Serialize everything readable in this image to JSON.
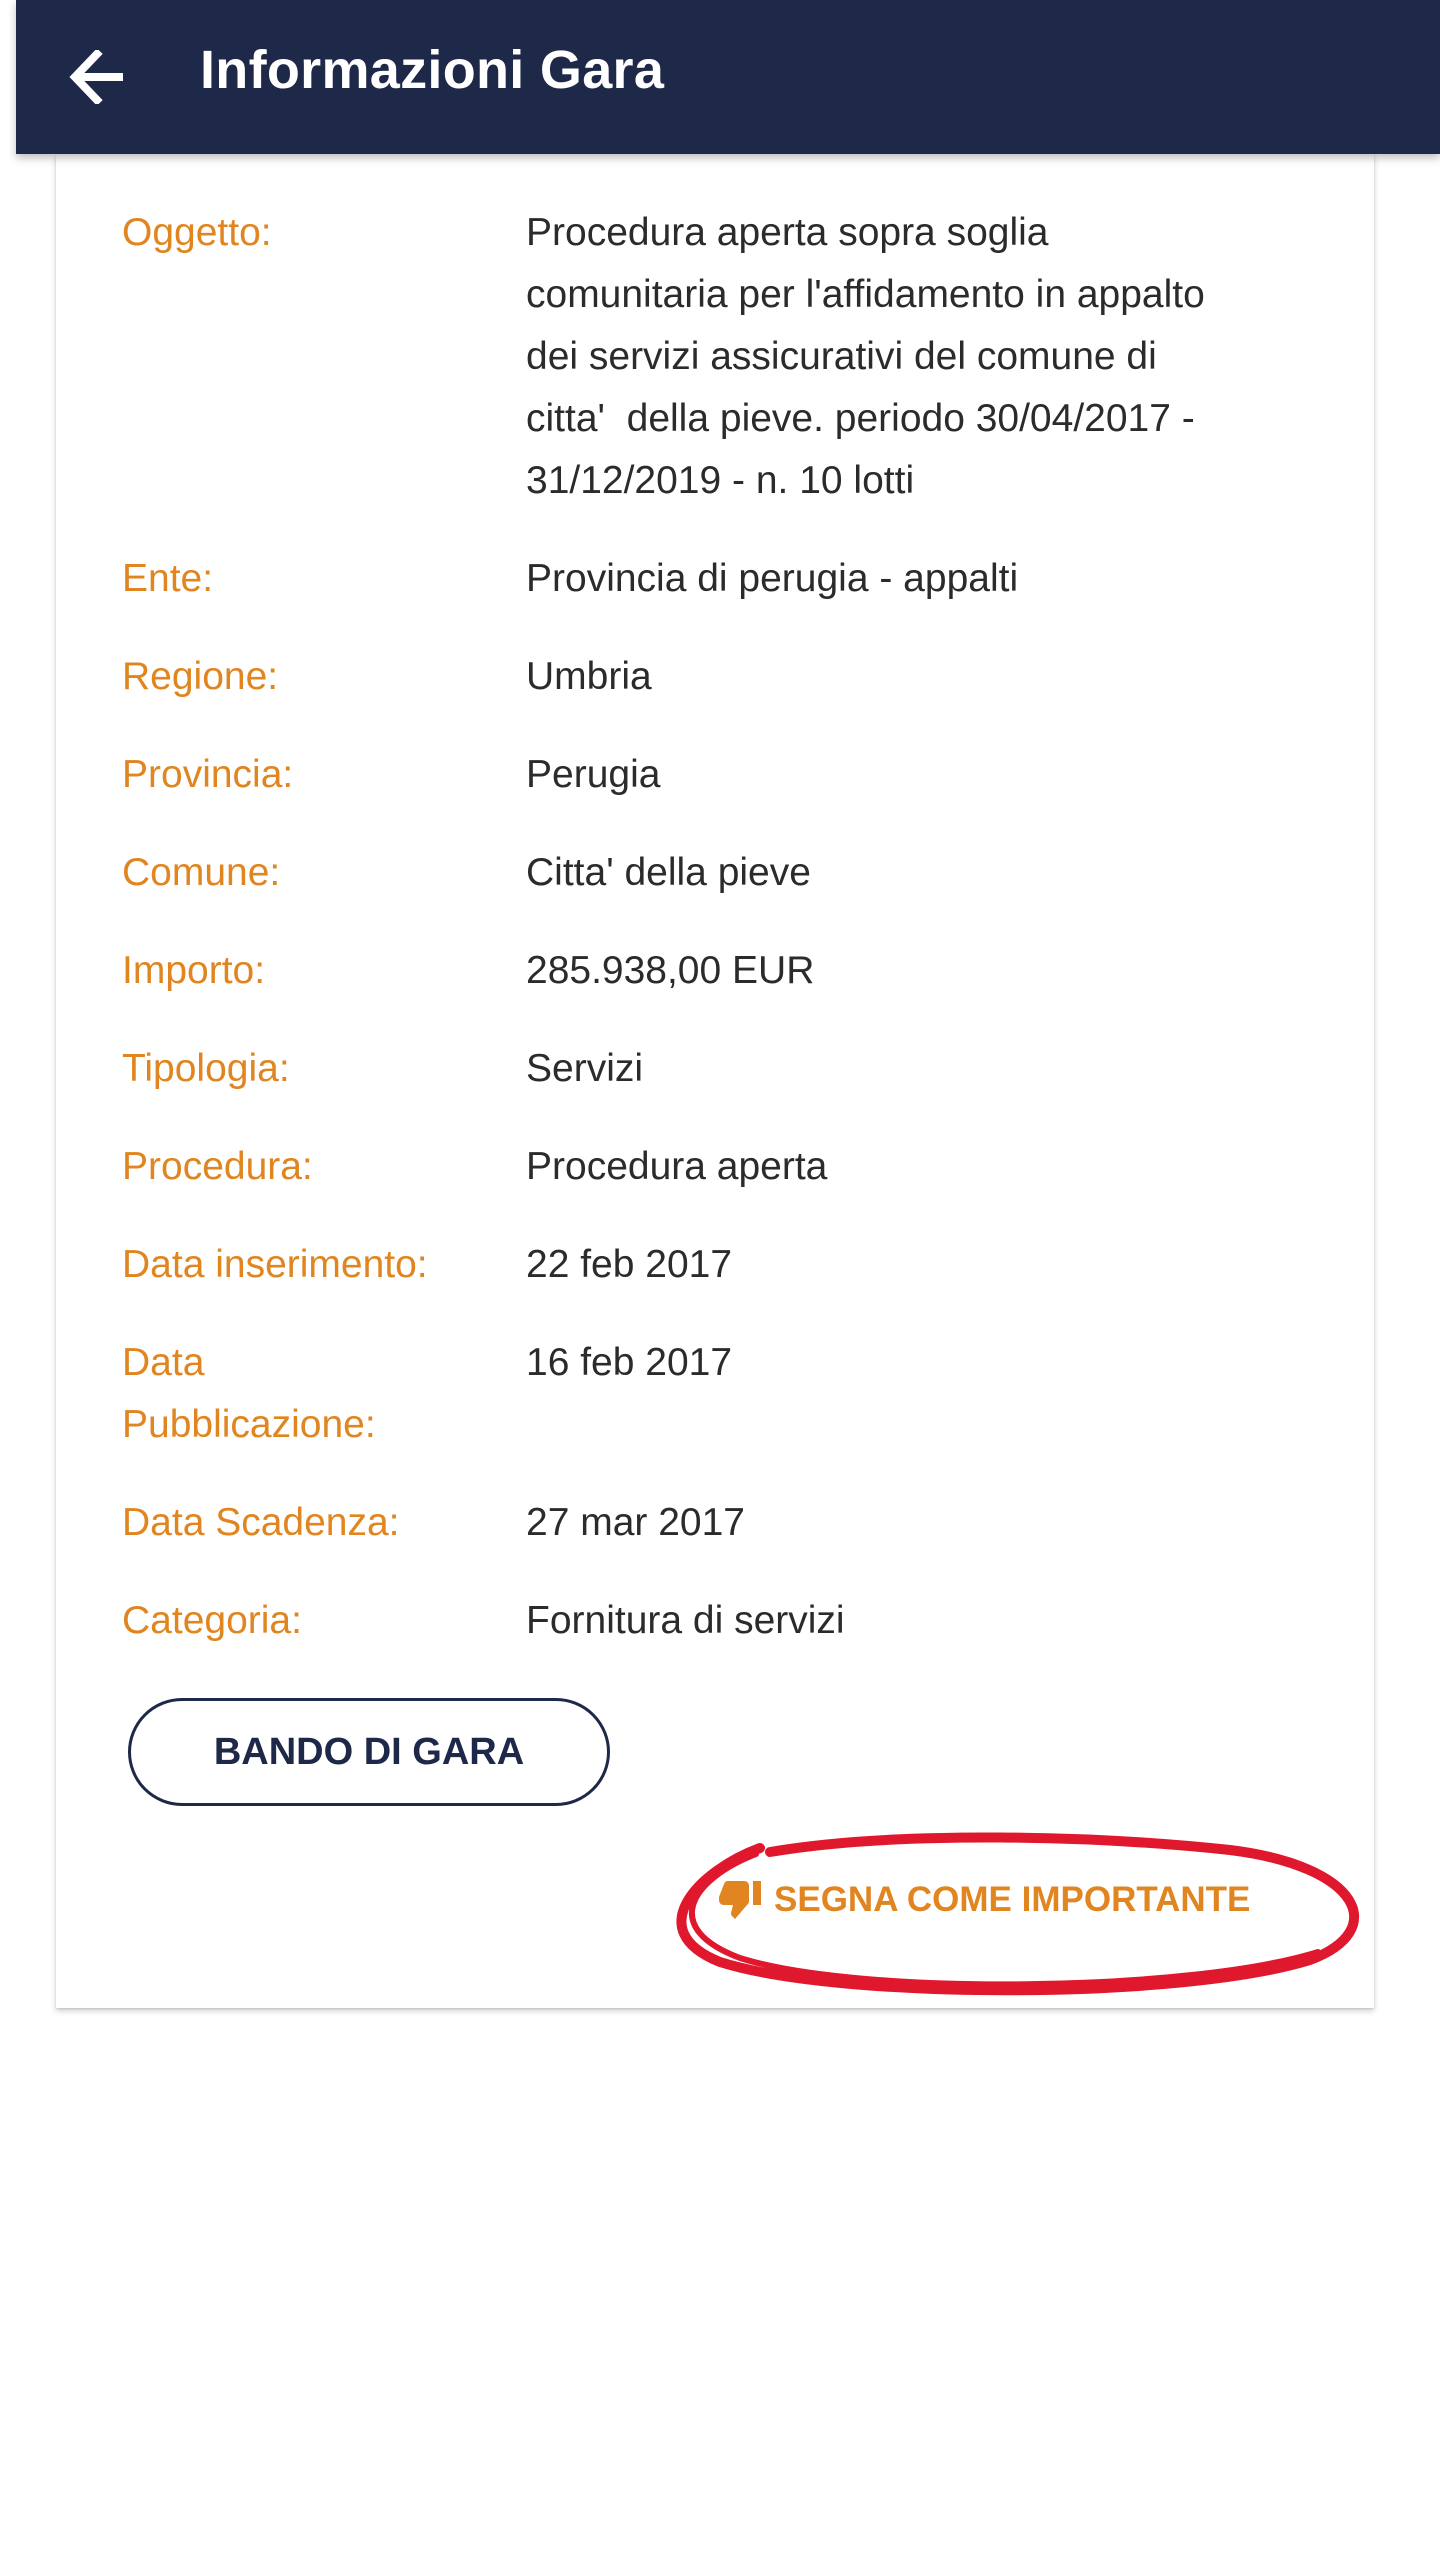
{
  "app_bar": {
    "title": "Informazioni Gara",
    "back_icon": "arrow-left-icon",
    "background": "#1e2848"
  },
  "details": {
    "oggetto": {
      "label": "Oggetto:",
      "value_lines": [
        "Procedura aperta sopra soglia",
        "comunitaria per l'affidamento in appalto",
        "dei servizi assicurativi del comune di",
        "citta'  della pieve. periodo 30/04/2017 -",
        "31/12/2019 - n. 10 lotti"
      ]
    },
    "ente": {
      "label": "Ente:",
      "value": "Provincia di perugia - appalti"
    },
    "regione": {
      "label": "Regione:",
      "value": "Umbria"
    },
    "provincia": {
      "label": "Provincia:",
      "value": "Perugia"
    },
    "comune": {
      "label": "Comune:",
      "value": "Citta' della pieve"
    },
    "importo": {
      "label": "Importo:",
      "value": "285.938,00 EUR"
    },
    "tipologia": {
      "label": "Tipologia:",
      "value": "Servizi"
    },
    "procedura": {
      "label": "Procedura:",
      "value": "Procedura aperta"
    },
    "data_inserimento": {
      "label": "Data inserimento:",
      "value": "22 feb 2017"
    },
    "data_pubblicazione": {
      "label_lines": [
        "Data",
        "Pubblicazione:"
      ],
      "value": "16 feb 2017"
    },
    "data_scadenza": {
      "label": "Data Scadenza:",
      "value": "27 mar 2017"
    },
    "categoria": {
      "label": "Categoria:",
      "value": "Fornitura di servizi"
    }
  },
  "actions": {
    "bando_label": "BANDO DI GARA",
    "important_label": "SEGNA COME IMPORTANTE",
    "important_icon": "thumbs-down-icon"
  },
  "colors": {
    "label": "#e0851f",
    "value": "#2b2b2b",
    "accent": "#e0851f",
    "primary": "#1e2848",
    "annotation": "#e0182d"
  }
}
